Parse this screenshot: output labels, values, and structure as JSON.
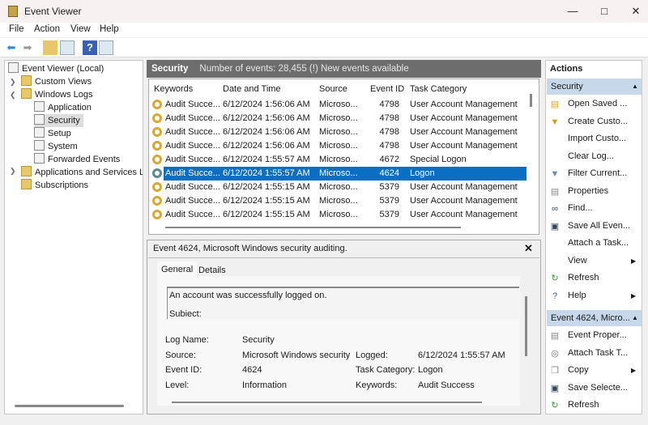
{
  "window": {
    "title": "Event Viewer",
    "controls": [
      "minimize",
      "maximize",
      "close"
    ]
  },
  "menu": [
    "File",
    "Action",
    "View",
    "Help"
  ],
  "toolbar": [
    "back-icon",
    "forward-icon",
    "open-folder-icon",
    "show-hide-tree-icon",
    "help-icon",
    "show-hide-action-icon"
  ],
  "tree": {
    "root": "Event Viewer (Local)",
    "custom_views": "Custom Views",
    "windows_logs": "Windows Logs",
    "logs": [
      "Application",
      "Security",
      "Setup",
      "System",
      "Forwarded Events"
    ],
    "apps_services": "Applications and Services Lo",
    "subscriptions": "Subscriptions",
    "selected": "Security"
  },
  "main": {
    "log_name": "Security",
    "status": "Number of events: 28,455 (!) New events available",
    "columns": [
      "Keywords",
      "Date and Time",
      "Source",
      "Event ID",
      "Task Category"
    ],
    "rows": [
      [
        "Audit Succe...",
        "6/12/2024 1:56:06 AM",
        "Microso...",
        "4798",
        "User Account Management"
      ],
      [
        "Audit Succe...",
        "6/12/2024 1:56:06 AM",
        "Microso...",
        "4798",
        "User Account Management"
      ],
      [
        "Audit Succe...",
        "6/12/2024 1:56:06 AM",
        "Microso...",
        "4798",
        "User Account Management"
      ],
      [
        "Audit Succe...",
        "6/12/2024 1:56:06 AM",
        "Microso...",
        "4798",
        "User Account Management"
      ],
      [
        "Audit Succe...",
        "6/12/2024 1:55:57 AM",
        "Microso...",
        "4672",
        "Special Logon"
      ],
      [
        "Audit Succe...",
        "6/12/2024 1:55:57 AM",
        "Microso...",
        "4624",
        "Logon"
      ],
      [
        "Audit Succe...",
        "6/12/2024 1:55:15 AM",
        "Microso...",
        "5379",
        "User Account Management"
      ],
      [
        "Audit Succe...",
        "6/12/2024 1:55:15 AM",
        "Microso...",
        "5379",
        "User Account Management"
      ],
      [
        "Audit Succe...",
        "6/12/2024 1:55:15 AM",
        "Microso...",
        "5379",
        "User Account Management"
      ]
    ],
    "selected_row": 5,
    "selection_color": "#0a6fc2"
  },
  "detail": {
    "title": "Event 4624, Microsoft Windows security auditing.",
    "tabs": [
      "General",
      "Details"
    ],
    "message": "An account was successfully logged on.",
    "message2": "Subiect:",
    "fields": {
      "log_name_label": "Log Name:",
      "log_name": "Security",
      "source_label": "Source:",
      "source": "Microsoft Windows security",
      "logged_label": "Logged:",
      "logged": "6/12/2024 1:55:57 AM",
      "event_id_label": "Event ID:",
      "event_id": "4624",
      "task_label": "Task Category:",
      "task": "Logon",
      "level_label": "Level:",
      "level": "Information",
      "keywords_label": "Keywords:",
      "keywords": "Audit Success"
    }
  },
  "actions": {
    "title": "Actions",
    "section1": "Security",
    "items1": [
      "Open Saved ...",
      "Create Custo...",
      "Import Custo...",
      "Clear Log...",
      "Filter Current...",
      "Properties",
      "Find...",
      "Save All Even...",
      "Attach a Task...",
      "View",
      "Refresh",
      "Help"
    ],
    "section2": "Event 4624, Micro...",
    "items2": [
      "Event Proper...",
      "Attach Task T...",
      "Copy",
      "Save Selecte...",
      "Refresh"
    ]
  }
}
